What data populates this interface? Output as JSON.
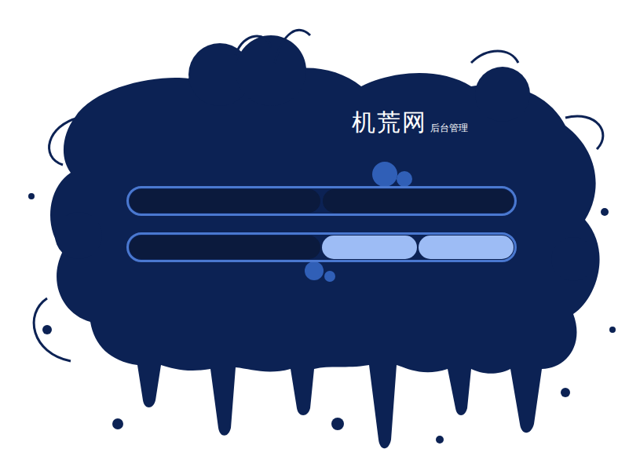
{
  "logo": {
    "title": "机荒网",
    "subtitle": "后台管理"
  }
}
